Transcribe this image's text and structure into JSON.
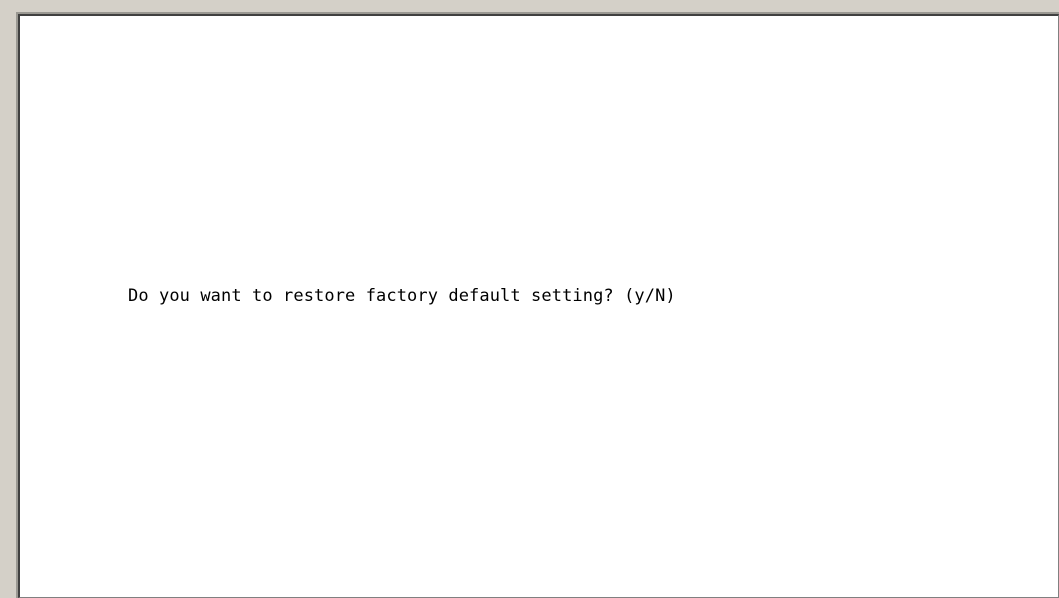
{
  "terminal": {
    "prompt": "Do you want to restore factory default setting? (y/N)"
  }
}
